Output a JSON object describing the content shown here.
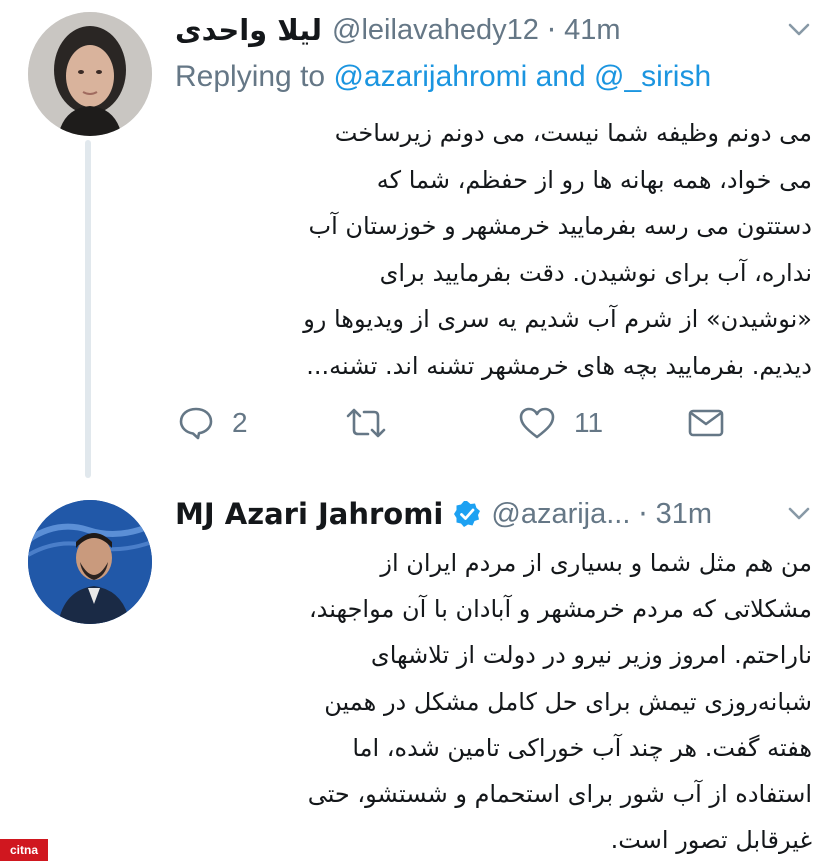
{
  "thread": {
    "tweets": [
      {
        "author_name": "لیلا واحدی",
        "handle": "@leilavahedy12",
        "separator": "·",
        "time": "41m",
        "replying_prefix": "Replying to ",
        "replying_user1": "@azarijahromi",
        "replying_and": " and ",
        "replying_user2": "@_sirish",
        "lines": [
          "می دونم وظیفه شما نیست، می دونم زیرساخت",
          "می خواد، همه بهانه ها رو از حفظم، شما که",
          "دستتون می رسه بفرمایید خرمشهر و خوزستان آب",
          "نداره، آب برای نوشیدن. دقت بفرمایید برای",
          "«نوشیدن» از شرم آب شدیم یه سری از ویدیوها رو",
          "دیدیم. بفرمایید بچه های خرمشهر تشنه اند. تشنه..."
        ],
        "actions": {
          "reply_count": "2",
          "retweet_count": "",
          "like_count": "11"
        }
      },
      {
        "author_name": "MJ Azari Jahromi",
        "handle": "@azarija...",
        "separator": "·",
        "time": "31m",
        "lines": [
          "من هم مثل شما و بسیاری از مردم ایران از",
          "مشکلاتی که مردم خرمشهر و آبادان با آن مواجهند،",
          "ناراحتم. امروز وزیر نیرو در دولت از تلاشهای",
          "شبانه‌روزی تیمش برای حل کامل مشکل در همین",
          "هفته گفت. هر چند آب خوراکی تامین شده، اما",
          "استفاده از آب شور  برای استحمام و شستشو، حتی",
          "غیرقابل تصور است."
        ]
      }
    ]
  },
  "watermark": {
    "label": "citna"
  },
  "colors": {
    "link": "#1b95e0",
    "secondary": "#657786",
    "verified": "#1da1f2",
    "thread_line": "#e1e8ed"
  }
}
